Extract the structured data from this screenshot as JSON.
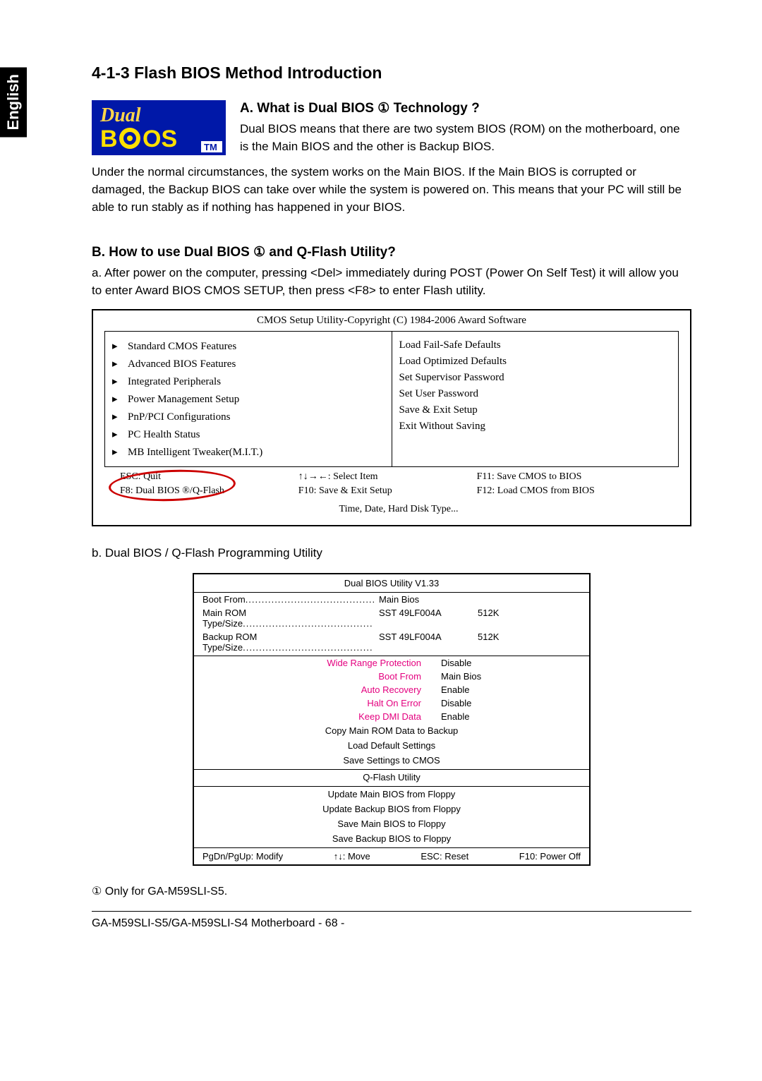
{
  "lang_tab": "English",
  "section_number_title": "4-1-3   Flash BIOS Method Introduction",
  "a_heading": "A.   What is Dual BIOS ① Technology ?",
  "a_para1": "Dual BIOS means that there are two system BIOS (ROM) on the motherboard, one is the Main BIOS and the other is Backup BIOS.",
  "a_para2": "Under the normal circumstances, the system works on the Main BIOS. If the Main BIOS is corrupted or damaged, the Backup BIOS can take over while the system is powered on. This means that your PC will still be able to run stably as if nothing has happened in your BIOS.",
  "b_heading": "B.   How to use Dual BIOS ① and Q-Flash Utility?",
  "b_para": "a. After power on the computer, pressing <Del> immediately during POST (Power On Self Test) it will allow you to enter Award BIOS CMOS SETUP, then press <F8> to enter Flash utility.",
  "cmos": {
    "title": "CMOS Setup Utility-Copyright (C) 1984-2006 Award Software",
    "left": [
      "Standard CMOS Features",
      "Advanced BIOS Features",
      "Integrated Peripherals",
      "Power Management Setup",
      "PnP/PCI Configurations",
      "PC Health Status",
      "MB Intelligent Tweaker(M.I.T.)"
    ],
    "right": [
      "Load Fail-Safe Defaults",
      "Load Optimized Defaults",
      "Set Supervisor Password",
      "Set User Password",
      "Save & Exit Setup",
      "Exit Without Saving"
    ],
    "footer": {
      "r1c1": "ESC: Quit",
      "r1c2": "↑↓→←: Select Item",
      "r1c3": "F11: Save CMOS to BIOS",
      "r2c1": "F8: Dual BIOS ®/Q-Flash",
      "r2c2": "F10: Save & Exit Setup",
      "r2c3": "F12: Load CMOS from BIOS",
      "bottom": "Time, Date, Hard Disk Type..."
    }
  },
  "b_sub": "b.    Dual BIOS / Q-Flash Programming Utility",
  "qflash": {
    "title": "Dual BIOS Utility V1.33",
    "info": [
      {
        "label": "Boot From",
        "v1": "Main Bios",
        "v2": ""
      },
      {
        "label": "Main ROM Type/Size",
        "v1": "SST 49LF004A",
        "v2": "512K"
      },
      {
        "label": "Backup ROM Type/Size",
        "v1": "SST 49LF004A",
        "v2": "512K"
      }
    ],
    "opts": [
      {
        "label": "Wide Range Protection",
        "val": "Disable"
      },
      {
        "label": "Boot From",
        "val": "Main Bios"
      },
      {
        "label": "Auto Recovery",
        "val": "Enable"
      },
      {
        "label": "Halt On Error",
        "val": "Disable"
      },
      {
        "label": "Keep DMI Data",
        "val": "Enable"
      }
    ],
    "actions1": [
      "Copy Main ROM Data to Backup",
      "Load Default Settings",
      "Save Settings to CMOS"
    ],
    "qflash_label": "Q-Flash Utility",
    "actions2": [
      "Update Main BIOS from Floppy",
      "Update Backup BIOS from Floppy",
      "Save Main BIOS to Floppy",
      "Save Backup BIOS to Floppy"
    ],
    "bottom": {
      "a": "PgDn/PgUp: Modify",
      "b": "↑↓: Move",
      "c": "ESC: Reset",
      "d": "F10: Power Off"
    }
  },
  "note": "① Only for GA-M59SLI-S5.",
  "footer": "GA-M59SLI-S5/GA-M59SLI-S4 Motherboard       - 68 -"
}
